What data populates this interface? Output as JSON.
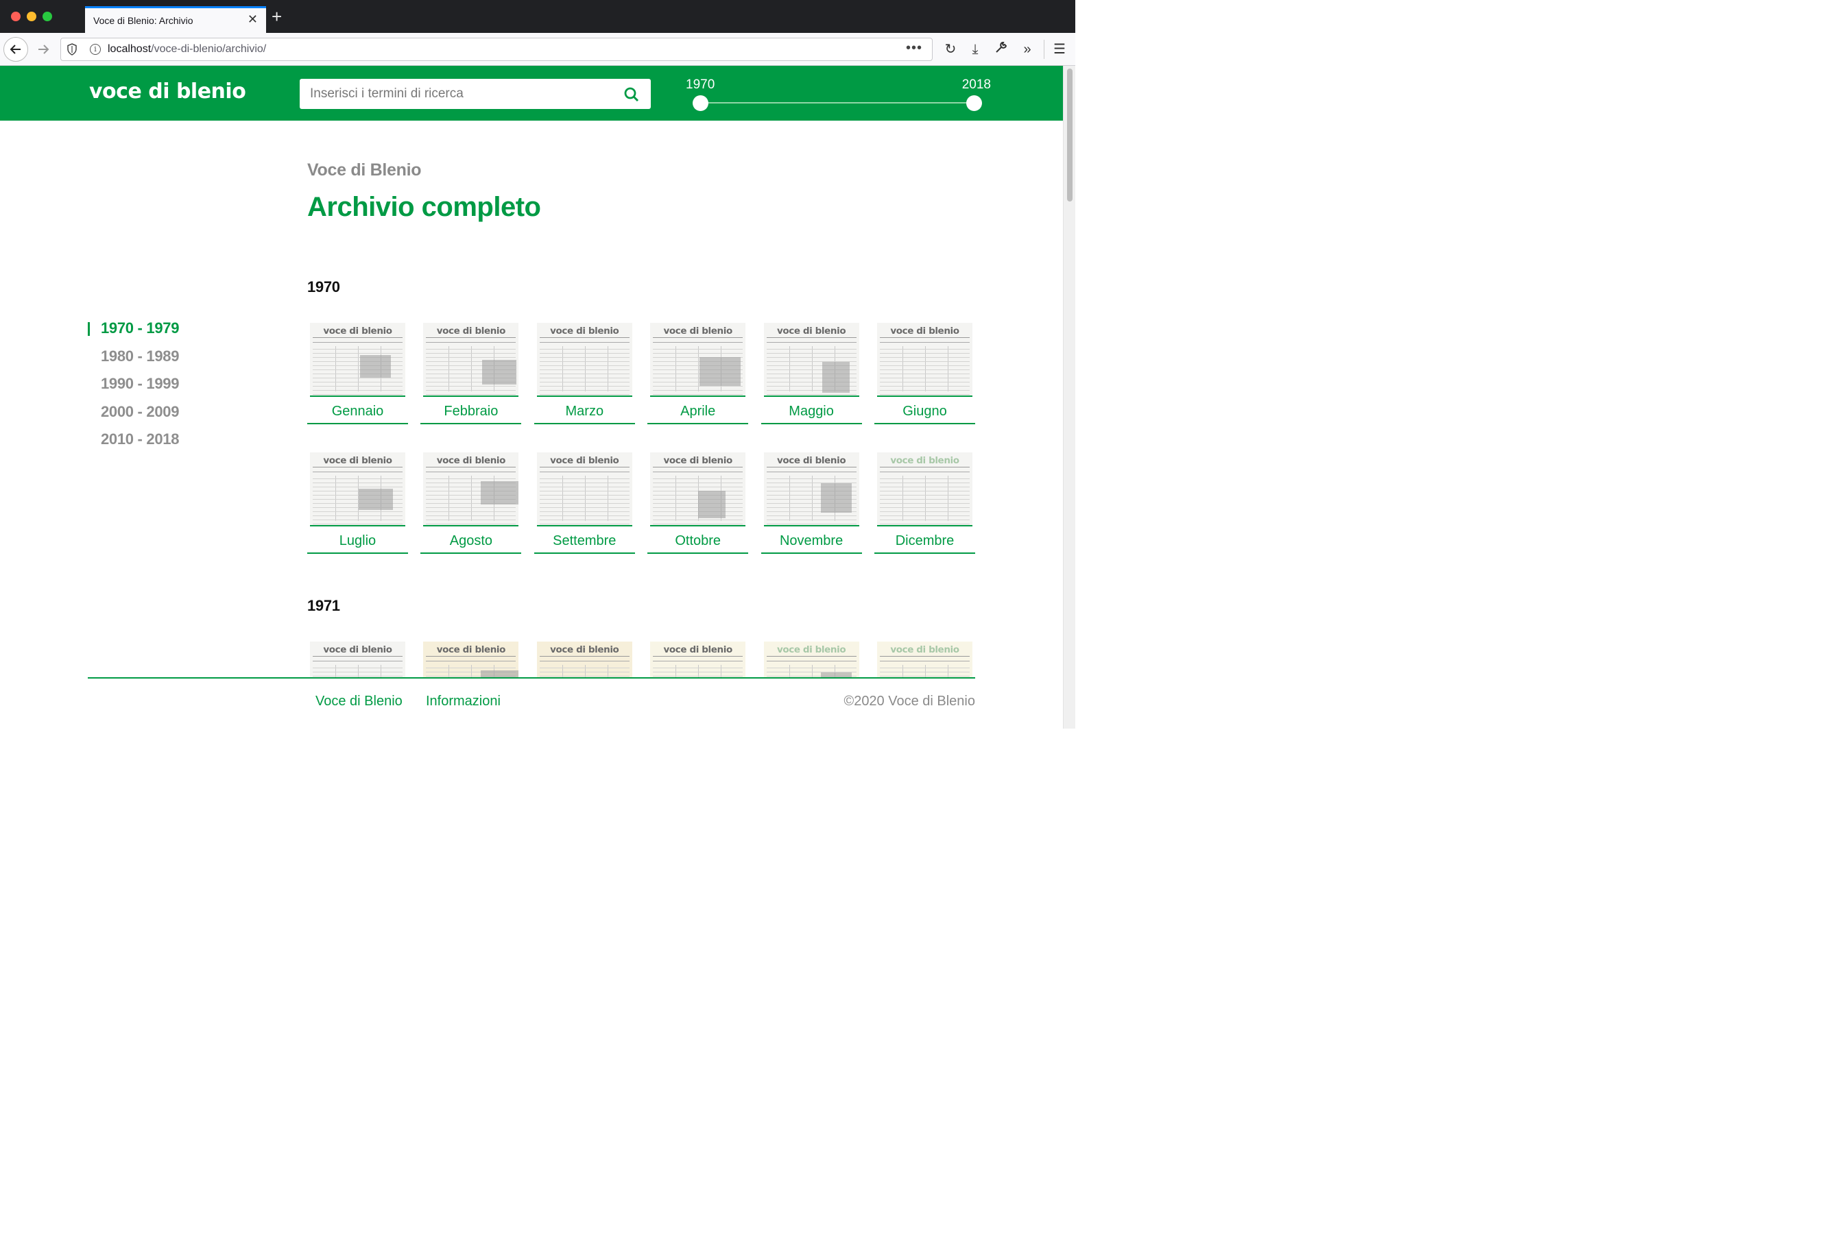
{
  "browser": {
    "tab_title": "Voce di Blenio: Archivio",
    "url_host": "localhost",
    "url_path": "/voce-di-blenio/archivio/"
  },
  "header": {
    "logo": "voce di blenio",
    "search_placeholder": "Inserisci i termini di ricerca",
    "range_min": "1970",
    "range_max": "2018",
    "brand_color": "#009a44"
  },
  "page": {
    "kicker": "Voce di Blenio",
    "title": "Archivio completo"
  },
  "decades": [
    "1970 - 1979",
    "1980 - 1989",
    "1990 - 1999",
    "2000 - 2009",
    "2010 - 2018"
  ],
  "active_decade": "1970 - 1979",
  "years": [
    {
      "year": "1970",
      "issues": [
        "Gennaio",
        "Febbraio",
        "Marzo",
        "Aprile",
        "Maggio",
        "Giugno",
        "Luglio",
        "Agosto",
        "Settembre",
        "Ottobre",
        "Novembre",
        "Dicembre"
      ]
    },
    {
      "year": "1971",
      "issues": [
        "",
        "",
        "",
        "",
        "",
        ""
      ]
    }
  ],
  "masthead": "voce di blenio",
  "footer": {
    "links": [
      "Voce di Blenio",
      "Informazioni"
    ],
    "copyright": "©2020 Voce di Blenio"
  }
}
